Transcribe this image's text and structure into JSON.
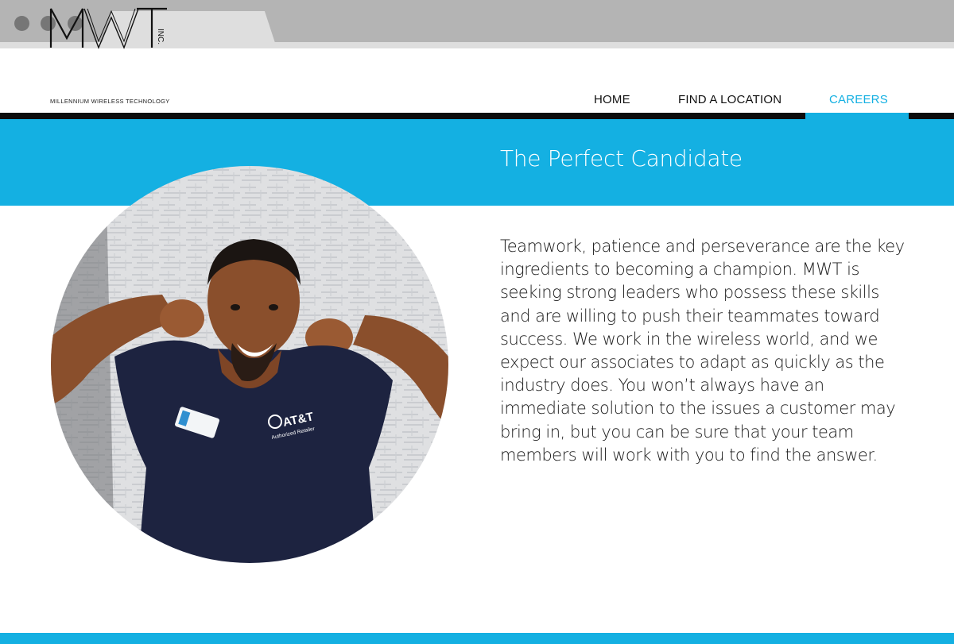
{
  "site": {
    "logo_text": "MWT",
    "logo_suffix": "INC.",
    "logo_tagline": "MILLENNIUM WIRELESS TECHNOLOGY"
  },
  "nav": {
    "items": [
      {
        "label": "HOME",
        "active": false
      },
      {
        "label": "FIND A LOCATION",
        "active": false
      },
      {
        "label": "CAREERS",
        "active": true
      }
    ]
  },
  "hero": {
    "title": "The Perfect Candidate"
  },
  "photo": {
    "shirt_text": "AT&T",
    "shirt_subtext": "Authorized Retailer"
  },
  "body": {
    "text": "Teamwork, patience and perseverance are the key ingredients to becoming a champion. MWT is seeking strong leaders who possess these skills and are willing to push their teammates toward success. We work in the wireless world, and we expect our associates to adapt as quickly as the industry does. You won’t always have an immediate solution to the issues a customer may bring in, but you can be sure that your team members will work with you to find the answer."
  },
  "colors": {
    "accent": "#14b0e2",
    "header_bar": "#0d0d0d",
    "chrome": "#b4b4b4"
  }
}
